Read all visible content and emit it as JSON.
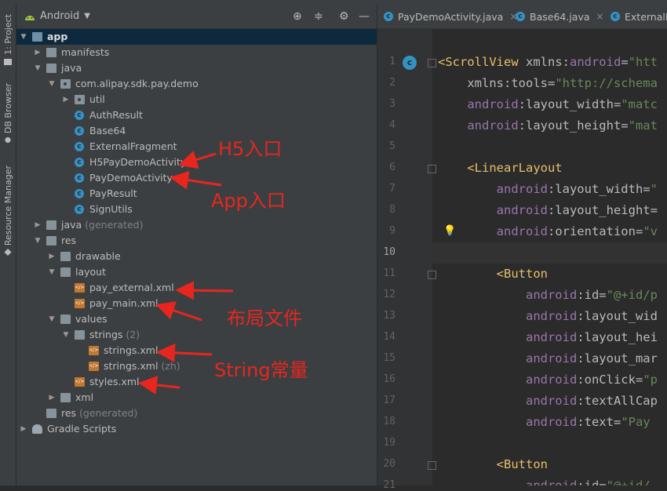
{
  "left_strip": {
    "tabs": [
      {
        "label": "1: Project",
        "icon": "project-folder-icon"
      },
      {
        "label": "DB Browser",
        "icon": "db-icon"
      },
      {
        "label": "Resource Manager",
        "icon": "resource-icon"
      }
    ]
  },
  "project_panel": {
    "view_mode": "Android",
    "toolbar_icons": [
      "locate-icon",
      "collapse-icon",
      "gear-icon",
      "hide-icon"
    ],
    "tree": [
      {
        "label": "app",
        "dim": ""
      },
      {
        "label": "manifests",
        "dim": ""
      },
      {
        "label": "java",
        "dim": ""
      },
      {
        "label": "com.alipay.sdk.pay.demo",
        "dim": ""
      },
      {
        "label": "util",
        "dim": ""
      },
      {
        "label": "AuthResult",
        "dim": ""
      },
      {
        "label": "Base64",
        "dim": ""
      },
      {
        "label": "ExternalFragment",
        "dim": ""
      },
      {
        "label": "H5PayDemoActivity",
        "dim": ""
      },
      {
        "label": "PayDemoActivity",
        "dim": ""
      },
      {
        "label": "PayResult",
        "dim": ""
      },
      {
        "label": "SignUtils",
        "dim": ""
      },
      {
        "label": "java",
        "dim": " (generated)"
      },
      {
        "label": "res",
        "dim": ""
      },
      {
        "label": "drawable",
        "dim": ""
      },
      {
        "label": "layout",
        "dim": ""
      },
      {
        "label": "pay_external.xml",
        "dim": ""
      },
      {
        "label": "pay_main.xml",
        "dim": ""
      },
      {
        "label": "values",
        "dim": ""
      },
      {
        "label": "strings",
        "dim": " (2)"
      },
      {
        "label": "strings.xml",
        "dim": ""
      },
      {
        "label": "strings.xml",
        "dim": " (zh)"
      },
      {
        "label": "styles.xml",
        "dim": ""
      },
      {
        "label": "xml",
        "dim": ""
      },
      {
        "label": "res",
        "dim": " (generated)"
      },
      {
        "label": "Gradle Scripts",
        "dim": ""
      }
    ]
  },
  "editor": {
    "tabs": [
      {
        "label": "PayDemoActivity.java",
        "icon": "class-icon"
      },
      {
        "label": "Base64.java",
        "icon": "class-icon"
      },
      {
        "label": "ExternalF",
        "icon": "class-icon"
      }
    ],
    "current_line": "10",
    "lines": [
      {
        "n": "1",
        "segs": [
          [
            "tag",
            "<ScrollView "
          ],
          [
            "attr",
            "xmlns:"
          ],
          [
            "ns",
            "android"
          ],
          [
            "attr",
            "="
          ],
          [
            "val",
            "\"htt"
          ]
        ]
      },
      {
        "n": "2",
        "segs": [
          [
            "attr",
            "    xmlns:tools="
          ],
          [
            "val",
            "\"http://schema"
          ]
        ]
      },
      {
        "n": "3",
        "segs": [
          [
            "ns",
            "    android"
          ],
          [
            "attr",
            ":layout_width="
          ],
          [
            "val",
            "\"matc"
          ]
        ]
      },
      {
        "n": "4",
        "segs": [
          [
            "ns",
            "    android"
          ],
          [
            "attr",
            ":layout_height="
          ],
          [
            "val",
            "\"mat"
          ]
        ]
      },
      {
        "n": "5",
        "segs": []
      },
      {
        "n": "6",
        "segs": [
          [
            "tag",
            "    <LinearLayout"
          ]
        ]
      },
      {
        "n": "7",
        "segs": [
          [
            "ns",
            "        android"
          ],
          [
            "attr",
            ":layout_width="
          ],
          [
            "val",
            "\""
          ]
        ]
      },
      {
        "n": "8",
        "segs": [
          [
            "ns",
            "        android"
          ],
          [
            "attr",
            ":layout_height="
          ]
        ]
      },
      {
        "n": "9",
        "segs": [
          [
            "ns",
            "        android"
          ],
          [
            "attr",
            ":orientation="
          ],
          [
            "val",
            "\"v"
          ]
        ]
      },
      {
        "n": "10",
        "segs": []
      },
      {
        "n": "11",
        "segs": [
          [
            "tag",
            "        <Button"
          ]
        ]
      },
      {
        "n": "12",
        "segs": [
          [
            "ns",
            "            android"
          ],
          [
            "attr",
            ":id="
          ],
          [
            "val",
            "\"@+id/p"
          ]
        ]
      },
      {
        "n": "13",
        "segs": [
          [
            "ns",
            "            android"
          ],
          [
            "attr",
            ":layout_wid"
          ]
        ]
      },
      {
        "n": "14",
        "segs": [
          [
            "ns",
            "            android"
          ],
          [
            "attr",
            ":layout_hei"
          ]
        ]
      },
      {
        "n": "15",
        "segs": [
          [
            "ns",
            "            android"
          ],
          [
            "attr",
            ":layout_mar"
          ]
        ]
      },
      {
        "n": "16",
        "segs": [
          [
            "ns",
            "            android"
          ],
          [
            "attr",
            ":onClick="
          ],
          [
            "val",
            "\"p"
          ]
        ]
      },
      {
        "n": "17",
        "segs": [
          [
            "ns",
            "            android"
          ],
          [
            "attr",
            ":textAllCap"
          ]
        ]
      },
      {
        "n": "18",
        "segs": [
          [
            "ns",
            "            android"
          ],
          [
            "attr",
            ":text="
          ],
          [
            "val",
            "\"Pay"
          ]
        ]
      },
      {
        "n": "19",
        "segs": []
      },
      {
        "n": "20",
        "segs": [
          [
            "tag",
            "        <Button"
          ]
        ]
      },
      {
        "n": "21",
        "segs": [
          [
            "ns",
            "            android"
          ],
          [
            "attr",
            ":id="
          ],
          [
            "val",
            "\"@+id/"
          ]
        ]
      }
    ]
  },
  "annotations": [
    {
      "text": "H5入口"
    },
    {
      "text": "App入口"
    },
    {
      "text": "布局文件"
    },
    {
      "text": "String常量"
    }
  ],
  "colors": {
    "annotation": "#e8261f",
    "selection": "#0d293e",
    "tag": "#e8bf6a",
    "namespace": "#9876aa",
    "value": "#6a8759"
  }
}
